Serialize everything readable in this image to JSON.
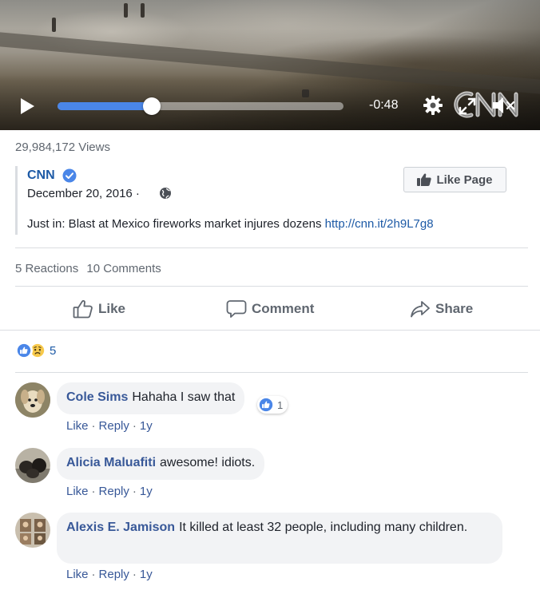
{
  "video": {
    "time_remaining": "-0:48",
    "progress_fraction": 0.33,
    "brand_logo": "CNN"
  },
  "post": {
    "views": "29,984,172 Views",
    "page_name": "CNN",
    "date": "December 20, 2016",
    "date_separator": "·",
    "text": "Just in: Blast at Mexico fireworks market injures dozens",
    "link": "http://cnn.it/2h9L7g8",
    "like_page_label": "Like Page",
    "reactions_label": "5 Reactions",
    "comments_label": "10 Comments"
  },
  "actions": {
    "like": "Like",
    "comment": "Comment",
    "share": "Share"
  },
  "reaction_summary": {
    "count": "5"
  },
  "comments": [
    {
      "name": "Cole Sims",
      "text": "Hahaha I saw that",
      "like": "Like",
      "reply": "Reply",
      "age": "1y",
      "reaction_count": "1"
    },
    {
      "name": "Alicia Maluafiti",
      "text": "awesome! idiots.",
      "like": "Like",
      "reply": "Reply",
      "age": "1y"
    },
    {
      "name": "Alexis E. Jamison",
      "text": "It killed at least 32 people, including many children.",
      "like": "Like",
      "reply": "Reply",
      "age": "1y"
    }
  ],
  "icons": {
    "verified": "verified-badge-icon",
    "globe": "globe-icon",
    "like_reaction": "like-reaction-icon",
    "sad_reaction": "sad-reaction-icon"
  },
  "colors": {
    "link": "#1d5aa6",
    "name": "#385898",
    "progress": "#4a86e8",
    "like_blue": "#1877f2"
  },
  "separator": "·"
}
